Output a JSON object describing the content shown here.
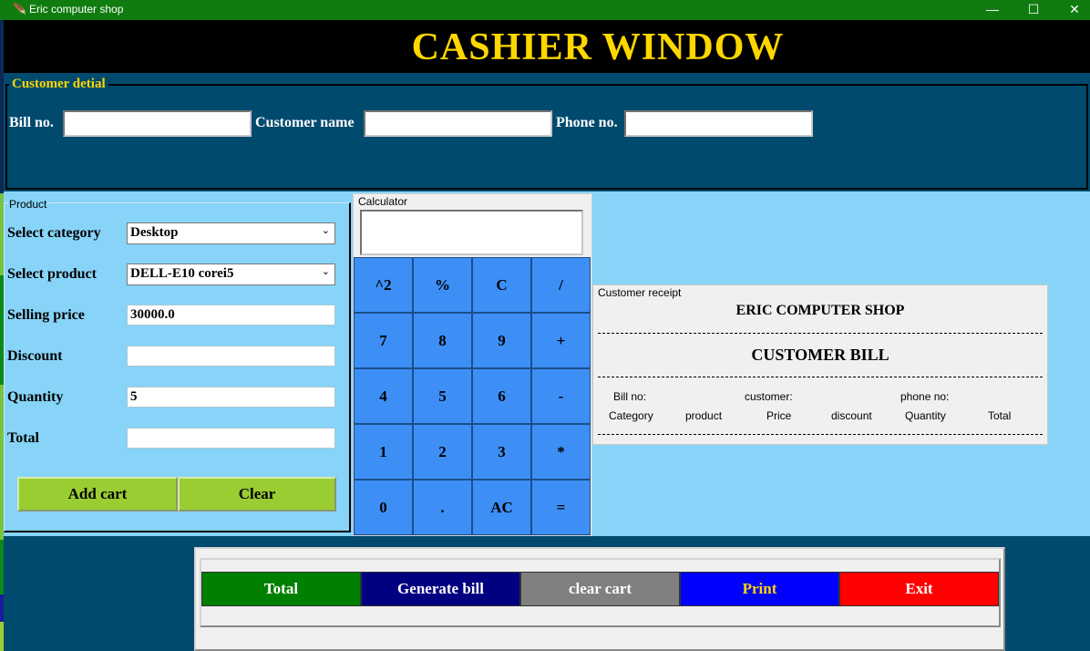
{
  "window": {
    "title": "Eric computer shop",
    "controls": {
      "minimize": "—",
      "maximize": "☐",
      "close": "✕"
    }
  },
  "header": {
    "title": "CASHIER WINDOW"
  },
  "customer": {
    "section_title": "Customer detial",
    "bill_label": "Bill no.",
    "bill_value": "",
    "name_label": "Customer name",
    "name_value": "",
    "phone_label": "Phone no.",
    "phone_value": ""
  },
  "product": {
    "section_title": "Product",
    "category_label": "Select category",
    "category_value": "Desktop",
    "product_label": "Select product",
    "product_value": "DELL-E10 corei5",
    "price_label": "Selling price",
    "price_value": "30000.0",
    "discount_label": "Discount",
    "discount_value": "",
    "quantity_label": "Quantity",
    "quantity_value": "5",
    "total_label": "Total",
    "total_value": "",
    "add_cart": "Add cart",
    "clear": "Clear"
  },
  "calculator": {
    "section_title": "Calculator",
    "display": "",
    "keys": [
      "^2",
      "%",
      "C",
      "/",
      "7",
      "8",
      "9",
      "+",
      "4",
      "5",
      "6",
      "-",
      "1",
      "2",
      "3",
      "*",
      "0",
      ".",
      "AC",
      "="
    ]
  },
  "receipt": {
    "section_title": "Customer receipt",
    "shop_name": "ERIC COMPUTER SHOP",
    "bill_title": "CUSTOMER BILL",
    "bill_no_label": "Bill no:",
    "customer_label": "customer:",
    "phone_label": "phone no:",
    "columns": [
      "Category",
      "product",
      "Price",
      "discount",
      "Quantity",
      "Total"
    ]
  },
  "actions": {
    "total": "Total",
    "generate_bill": "Generate bill",
    "clear_cart": "clear cart",
    "print": "Print",
    "exit": "Exit"
  },
  "colors": {
    "title_bar": "#107c10",
    "header_bg": "#000000",
    "header_text": "#ffd700",
    "dark_panel": "#004a6e",
    "light_panel": "#87d4f8",
    "calc_key": "#3d8ff5",
    "cart_button": "#9acd32",
    "total_button": "#008000",
    "generate_button": "#000080",
    "clear_cart_button": "#808080",
    "print_button": "#0000ff",
    "print_text": "#ffd700",
    "exit_button": "#ff0000"
  },
  "icons": {
    "app": "feather-icon",
    "dropdown": "chevron-down-icon"
  }
}
